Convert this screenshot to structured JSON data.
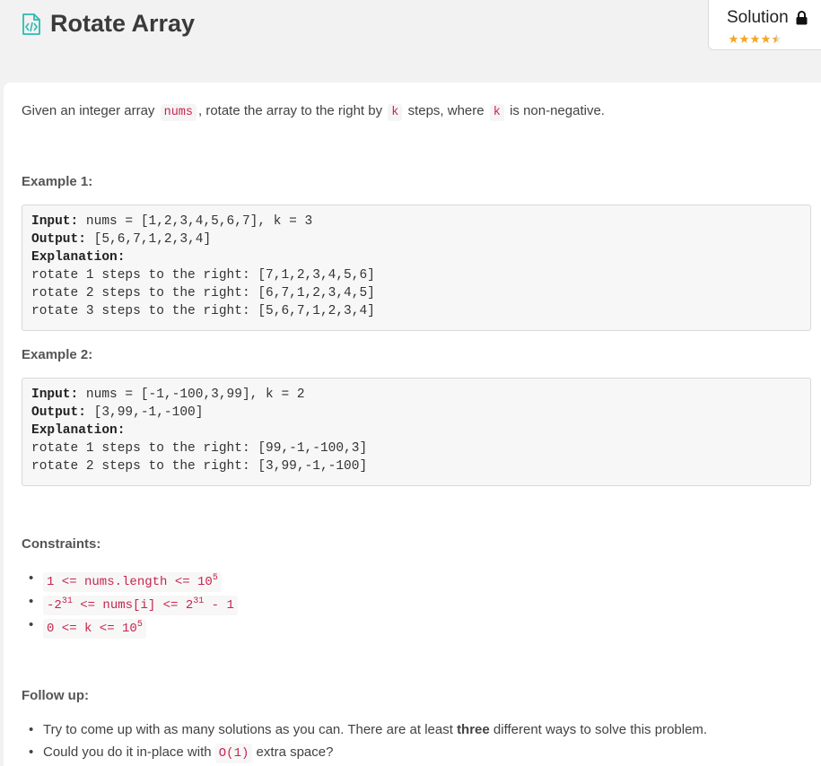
{
  "header": {
    "title": "Rotate Array",
    "solution_label": "Solution",
    "rating_stars": 4.5,
    "star_color": "#f5a623",
    "icons": [
      "code-file-icon",
      "lock-icon",
      "star-icon"
    ]
  },
  "description": {
    "p1": "Given an integer array",
    "c1": "nums",
    "p2": ", rotate the array to the right by",
    "c2": "k",
    "p3": "steps, where",
    "c3": "k",
    "p4": "is non-negative."
  },
  "examples": [
    {
      "heading": "Example 1:",
      "input_label": "Input:",
      "input_value": " nums = [1,2,3,4,5,6,7], k = 3",
      "output_label": "Output:",
      "output_value": " [5,6,7,1,2,3,4]",
      "explanation_label": "Explanation:",
      "lines": [
        "rotate 1 steps to the right: [7,1,2,3,4,5,6]",
        "rotate 2 steps to the right: [6,7,1,2,3,4,5]",
        "rotate 3 steps to the right: [5,6,7,1,2,3,4]"
      ]
    },
    {
      "heading": "Example 2:",
      "input_label": "Input:",
      "input_value": " nums = [-1,-100,3,99], k = 2",
      "output_label": "Output:",
      "output_value": " [3,99,-1,-100]",
      "explanation_label": "Explanation:",
      "lines": [
        "rotate 1 steps to the right: [99,-1,-100,3]",
        "rotate 2 steps to the right: [3,99,-1,-100]"
      ]
    }
  ],
  "constraints": {
    "heading": "Constraints:",
    "items": [
      {
        "pre": "1 <= nums.length <= 10",
        "sup": "5",
        "post": ""
      },
      {
        "pre": "-2",
        "sup": "31",
        "mid": " <= nums[i] <= 2",
        "sup2": "31",
        "post": " - 1"
      },
      {
        "pre": "0 <= k <= 10",
        "sup": "5",
        "post": ""
      }
    ]
  },
  "follow_up": {
    "heading": "Follow up:",
    "item1_pre": "Try to come up with as many solutions as you can. There are at least ",
    "item1_bold": "three",
    "item1_post": " different ways to solve this problem.",
    "item2_pre": "Could you do it in-place with ",
    "item2_code": "O(1)",
    "item2_post": " extra space?"
  },
  "colors": {
    "code_text": "#c7254e",
    "icon_teal": "#2cbbb0",
    "page_bg": "#f2f2f2"
  }
}
